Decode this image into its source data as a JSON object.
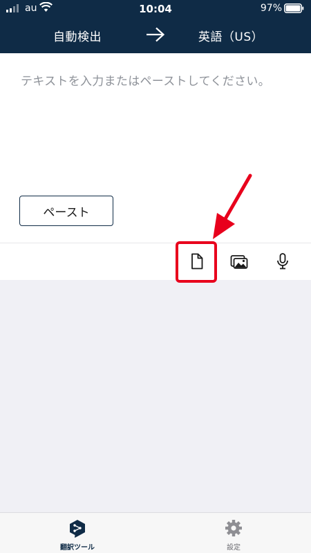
{
  "status_bar": {
    "carrier": "au",
    "time": "10:04",
    "battery": "97%"
  },
  "language_bar": {
    "source_language": "自動検出",
    "target_language": "英語（US）",
    "swap_icon": "arrow-right-icon"
  },
  "input": {
    "placeholder": "テキストを入力またはペーストしてください。",
    "paste_label": "ペースト"
  },
  "toolbar": {
    "icons": [
      "document-icon",
      "image-icon",
      "microphone-icon"
    ]
  },
  "bottom_nav": {
    "items": [
      {
        "label": "翻訳ツール",
        "icon": "deepl-logo-icon",
        "active": true
      },
      {
        "label": "設定",
        "icon": "gear-icon",
        "active": false
      }
    ]
  },
  "colors": {
    "header": "#0f2b46",
    "highlight": "#e8001c",
    "content_bg": "#f0f0f5"
  }
}
